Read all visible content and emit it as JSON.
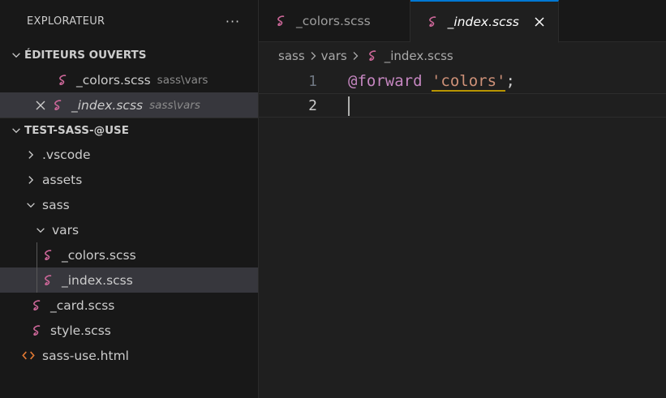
{
  "explorer": {
    "title": "EXPLORATEUR",
    "more_label": "···",
    "open_editors": {
      "title": "ÉDITEURS OUVERTS",
      "items": [
        {
          "name": "_colors.scss",
          "path": "sass\\vars"
        },
        {
          "name": "_index.scss",
          "path": "sass\\vars"
        }
      ]
    },
    "workspace": {
      "title": "TEST-SASS-@USE",
      "tree": [
        {
          "label": ".vscode"
        },
        {
          "label": "assets"
        },
        {
          "label": "sass"
        },
        {
          "label": "vars"
        },
        {
          "label": "_colors.scss"
        },
        {
          "label": "_index.scss"
        },
        {
          "label": "_card.scss"
        },
        {
          "label": "style.scss"
        },
        {
          "label": "sass-use.html"
        }
      ]
    }
  },
  "tabs": [
    {
      "label": "_colors.scss"
    },
    {
      "label": "_index.scss"
    }
  ],
  "breadcrumb": [
    "sass",
    "vars",
    "_index.scss"
  ],
  "code": {
    "lines": [
      {
        "number": "1",
        "keyword": "@forward",
        "string": "'colors'",
        "punct": ";"
      },
      {
        "number": "2"
      }
    ]
  },
  "colors": {
    "sass_pink": "#cd6799",
    "html_orange": "#e37933",
    "accent": "#0078d4"
  }
}
